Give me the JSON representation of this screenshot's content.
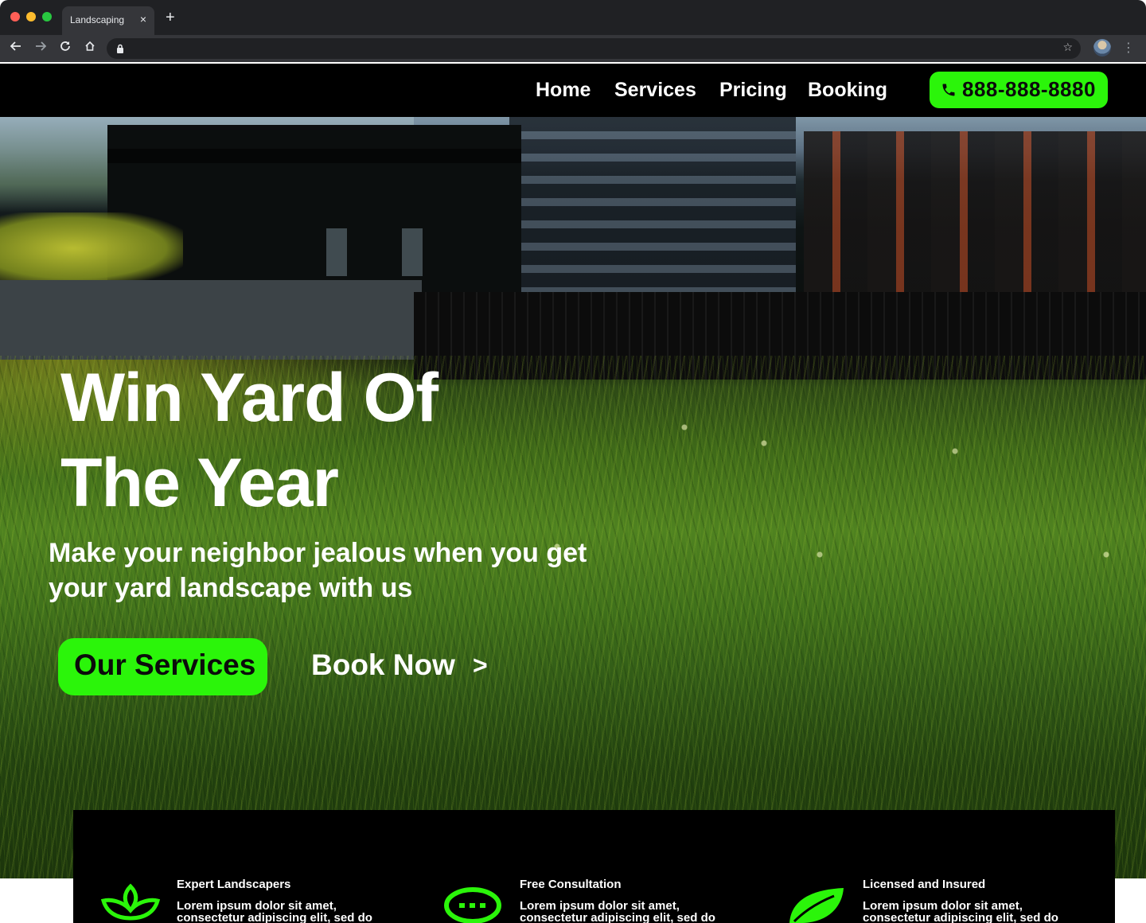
{
  "browser": {
    "tab_title": "Landscaping",
    "tab_close": "×",
    "new_tab": "+"
  },
  "nav": {
    "links": [
      "Home",
      "Services",
      "Pricing",
      "Booking"
    ],
    "phone": "888-888-8880"
  },
  "hero": {
    "title_line1": "Win Yard Of",
    "title_line2": "The Year",
    "subtitle": "Make your neighbor jealous when you get your yard landscape with us",
    "primary_cta": "Our Services",
    "secondary_cta": "Book Now",
    "secondary_cta_arrow": ">"
  },
  "features": [
    {
      "title": "Expert Landscapers",
      "text": "Lorem ipsum dolor sit amet, consectetur adipiscing elit, sed do",
      "icon": "lotus-icon"
    },
    {
      "title": "Free Consultation",
      "text": "Lorem ipsum dolor sit amet, consectetur adipiscing elit, sed do",
      "icon": "chat-bubble-icon"
    },
    {
      "title": "Licensed and Insured",
      "text": "Lorem ipsum dolor sit amet, consectetur adipiscing elit, sed do",
      "icon": "leaf-icon"
    }
  ],
  "colors": {
    "accent": "#2bf50a",
    "nav_bg": "#000000",
    "chrome_dark": "#202124",
    "chrome_toolbar": "#35363a"
  }
}
